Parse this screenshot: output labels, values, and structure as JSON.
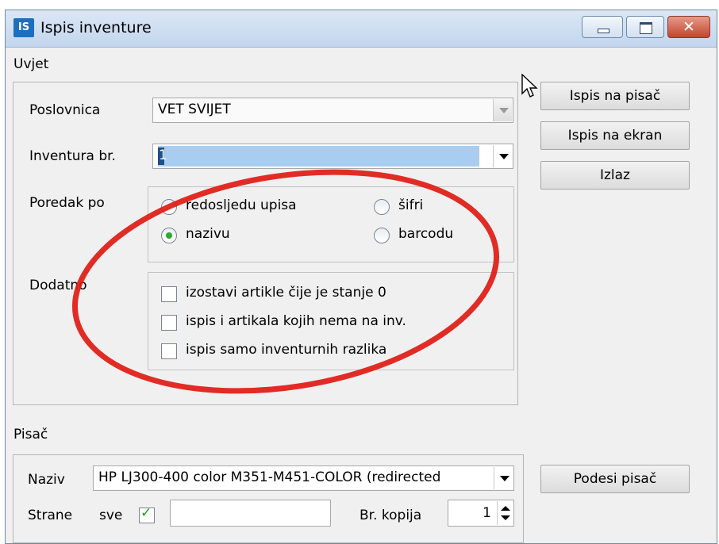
{
  "window": {
    "title": "Ispis inventure",
    "app_icon": "IS"
  },
  "colors": {
    "accent": "#1e6ebd",
    "selection": "#a9cdf0",
    "check_green": "#2fa82f",
    "annotation_red": "#e01b14"
  },
  "uvjet": {
    "label": "Uvjet",
    "poslovnica": {
      "label": "Poslovnica",
      "value": "VET SVIJET"
    },
    "inventura": {
      "label": "Inventura br.",
      "value": "1"
    },
    "poredak": {
      "label": "Poredak po",
      "options": [
        "redosljedu upisa",
        "šifri",
        "nazivu",
        "barcodu"
      ],
      "selected": "nazivu"
    },
    "dodatno": {
      "label": "Dodatno",
      "options": [
        "izostavi artikle čije je stanje 0",
        "ispis i artikala kojih nema na inv.",
        "ispis samo inventurnih razlika"
      ]
    }
  },
  "buttons": {
    "ispis_na_pisac": "Ispis na pisač",
    "ispis_na_ekran": "Ispis na ekran",
    "izlaz": "Izlaz",
    "podesi_pisac": "Podesi pisač"
  },
  "pisac": {
    "label": "Pisač",
    "naziv_label": "Naziv",
    "naziv_value": "HP LJ300-400 color M351-M451-COLOR (redirected",
    "strane_label": "Strane",
    "sve_label": "sve",
    "sve_checked": true,
    "kopija_label": "Br. kopija",
    "kopija_value": "1"
  }
}
